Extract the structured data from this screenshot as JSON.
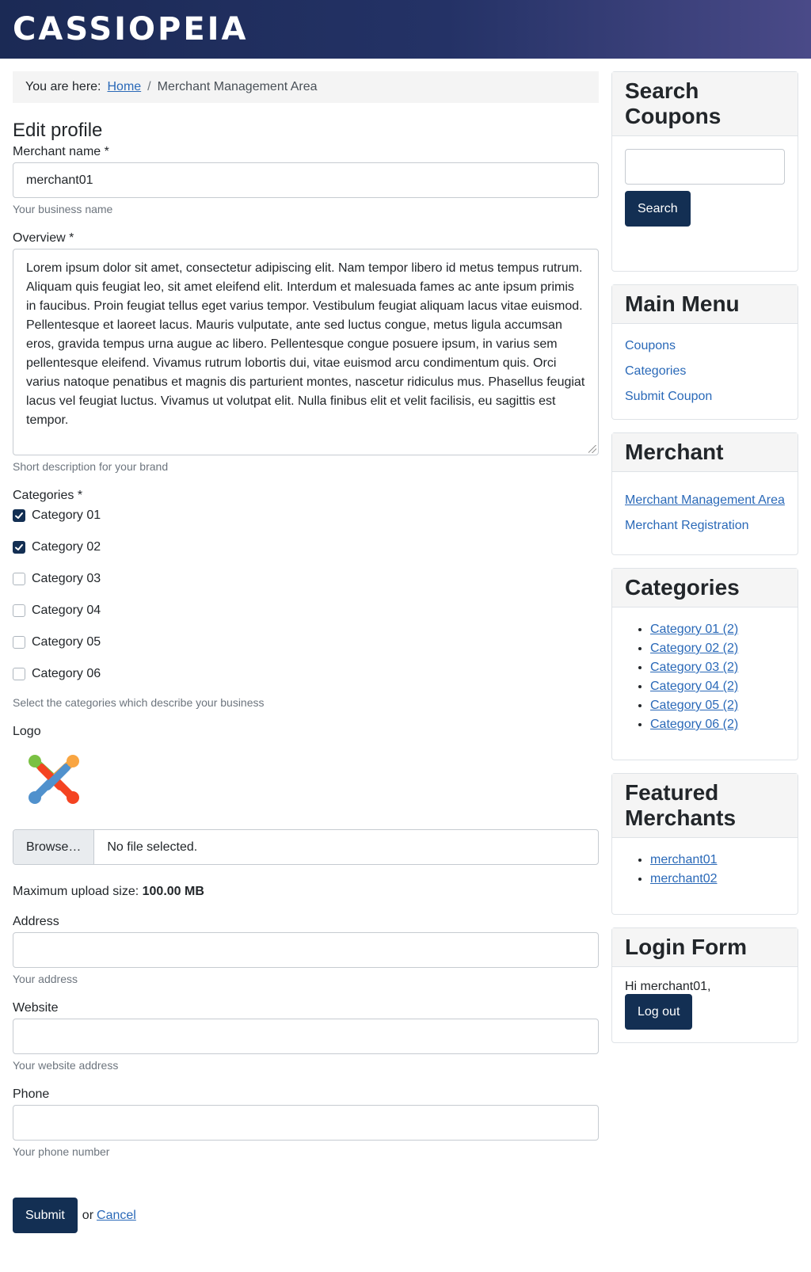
{
  "brand": "CASSIOPEIA",
  "breadcrumb": {
    "prefix": "You are here:",
    "home": "Home",
    "separator": "/",
    "current": "Merchant Management Area"
  },
  "form": {
    "heading": "Edit profile",
    "merchant_name": {
      "label": "Merchant name *",
      "value": "merchant01",
      "hint": "Your business name"
    },
    "overview": {
      "label": "Overview *",
      "value": "Lorem ipsum dolor sit amet, consectetur adipiscing elit. Nam tempor libero id metus tempus rutrum. Aliquam quis feugiat leo, sit amet eleifend elit. Interdum et malesuada fames ac ante ipsum primis in faucibus. Proin feugiat tellus eget varius tempor. Vestibulum feugiat aliquam lacus vitae euismod. Pellentesque et laoreet lacus. Mauris vulputate, ante sed luctus congue, metus ligula accumsan eros, gravida tempus urna augue ac libero. Pellentesque congue posuere ipsum, in varius sem pellentesque eleifend. Vivamus rutrum lobortis dui, vitae euismod arcu condimentum quis. Orci varius natoque penatibus et magnis dis parturient montes, nascetur ridiculus mus. Phasellus feugiat lacus vel feugiat luctus. Vivamus ut volutpat elit. Nulla finibus elit et velit facilisis, eu sagittis est tempor.",
      "hint": "Short description for your brand"
    },
    "categories": {
      "label": "Categories *",
      "items": [
        {
          "label": "Category 01",
          "checked": true
        },
        {
          "label": "Category 02",
          "checked": true
        },
        {
          "label": "Category 03",
          "checked": false
        },
        {
          "label": "Category 04",
          "checked": false
        },
        {
          "label": "Category 05",
          "checked": false
        },
        {
          "label": "Category 06",
          "checked": false
        }
      ],
      "hint": "Select the categories which describe your business"
    },
    "logo": {
      "label": "Logo",
      "browse": "Browse…",
      "file_status": "No file selected.",
      "max_upload_label": "Maximum upload size:",
      "max_upload_value": "100.00 MB"
    },
    "address": {
      "label": "Address",
      "value": "",
      "hint": "Your address"
    },
    "website": {
      "label": "Website",
      "value": "",
      "hint": "Your website address"
    },
    "phone": {
      "label": "Phone",
      "value": "",
      "hint": "Your phone number"
    },
    "submit": "Submit",
    "or": "or",
    "cancel": "Cancel"
  },
  "sidebar": {
    "search": {
      "title": "Search Coupons",
      "value": "",
      "button": "Search"
    },
    "main_menu": {
      "title": "Main Menu",
      "items": [
        "Coupons",
        "Categories",
        "Submit Coupon"
      ]
    },
    "merchant": {
      "title": "Merchant",
      "items": [
        "Merchant Management Area",
        "Merchant Registration"
      ]
    },
    "categories": {
      "title": "Categories",
      "items": [
        "Category 01 (2)",
        "Category 02 (2)",
        "Category 03 (2)",
        "Category 04 (2)",
        "Category 05 (2)",
        "Category 06 (2)"
      ]
    },
    "featured": {
      "title": "Featured Merchants",
      "items": [
        "merchant01",
        "merchant02"
      ]
    },
    "login": {
      "title": "Login Form",
      "greeting": "Hi merchant01,",
      "button": "Log out"
    }
  },
  "colors": {
    "primary": "#132f53",
    "link": "#2a69b8",
    "header_start": "#1b2a55",
    "header_end": "#4a4a88"
  }
}
